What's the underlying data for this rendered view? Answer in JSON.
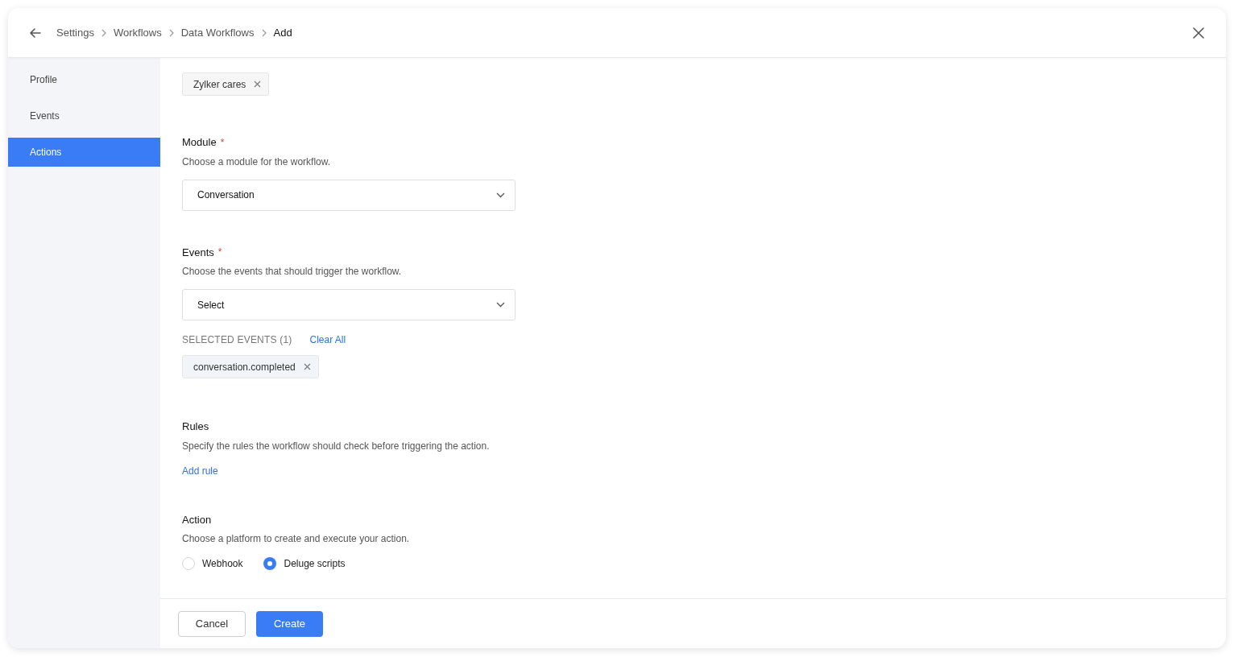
{
  "breadcrumb": [
    "Settings",
    "Workflows",
    "Data Workflows",
    "Add"
  ],
  "sidebar": {
    "items": [
      {
        "label": "Profile",
        "selected": false
      },
      {
        "label": "Events",
        "selected": false
      },
      {
        "label": "Actions",
        "selected": true
      }
    ]
  },
  "brands": {
    "chips": [
      "Zylker cares"
    ]
  },
  "module": {
    "title": "Module",
    "required_mark": "*",
    "hint": "Choose a module for the workflow.",
    "value": "Conversation"
  },
  "events": {
    "title": "Events",
    "required_mark": "*",
    "hint": "Choose the events that should trigger the workflow.",
    "value": "Select",
    "selected_label": "SELECTED EVENTS (1)",
    "clear": "Clear All",
    "chips": [
      "conversation.completed"
    ]
  },
  "rules": {
    "title": "Rules",
    "hint": "Specify the rules the workflow should check before triggering the action.",
    "link": "Add rule"
  },
  "action": {
    "title": "Action",
    "hint": "Choose a platform to create and execute your action.",
    "options": [
      {
        "label": "Webhook",
        "selected": false
      },
      {
        "label": "Deluge scripts",
        "selected": true
      }
    ]
  },
  "buttons": {
    "cancel": "Cancel",
    "create": "Create"
  }
}
